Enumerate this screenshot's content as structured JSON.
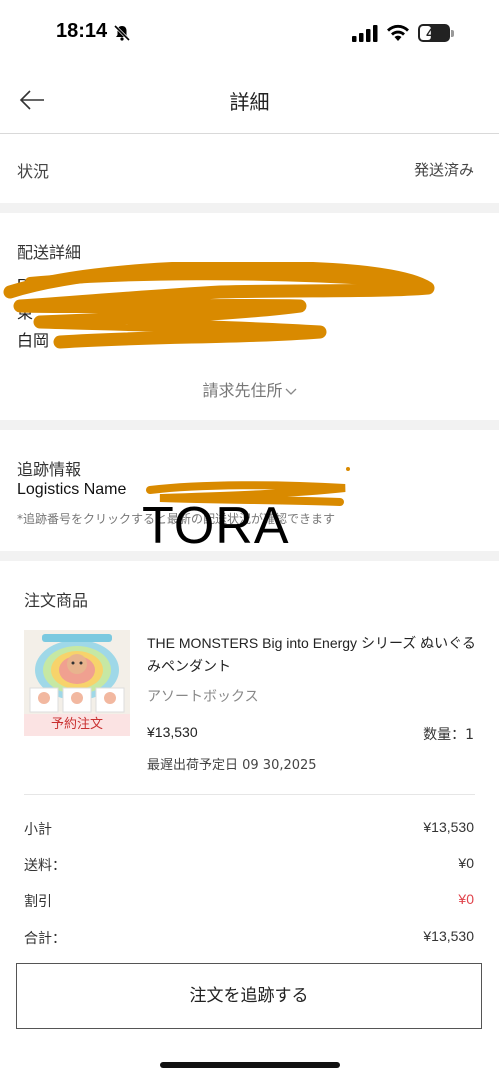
{
  "status_bar": {
    "time": "18:14",
    "battery": "40",
    "battery_fraction": 0.4
  },
  "header": {
    "title": "詳細"
  },
  "order_status": {
    "label": "状況",
    "value": "発送済み"
  },
  "delivery": {
    "title": "配送詳細",
    "billing_address_link": "請求先住所"
  },
  "tracking": {
    "title": "追跡情報",
    "logistics_label": "Logistics Name",
    "note": "*追跡番号をクリックすると最新の配送状況が確認できます",
    "overlay_text": "TORA"
  },
  "products": {
    "title": "注文商品",
    "item": {
      "name": "THE MONSTERS Big into Energy シリーズ ぬいぐるみペンダント",
      "variant": "アソートボックス",
      "price": "¥13,530",
      "quantity": "数量：1",
      "ship_date": "最遅出荷予定日 09 30,2025",
      "badge": "予約注文"
    }
  },
  "summary": {
    "subtotal_label": "小計",
    "subtotal": "¥13,530",
    "shipping_label": "送料：",
    "shipping": "¥0",
    "discount_label": "割引",
    "discount": "¥0",
    "total_label": "合計：",
    "total": "¥13,530"
  },
  "actions": {
    "track_order": "注文を追跡する"
  },
  "colors": {
    "discount": "#e0434b",
    "badge_bg": "#fbe3e3",
    "badge_text": "#c93030",
    "redaction": "#d98a00"
  }
}
